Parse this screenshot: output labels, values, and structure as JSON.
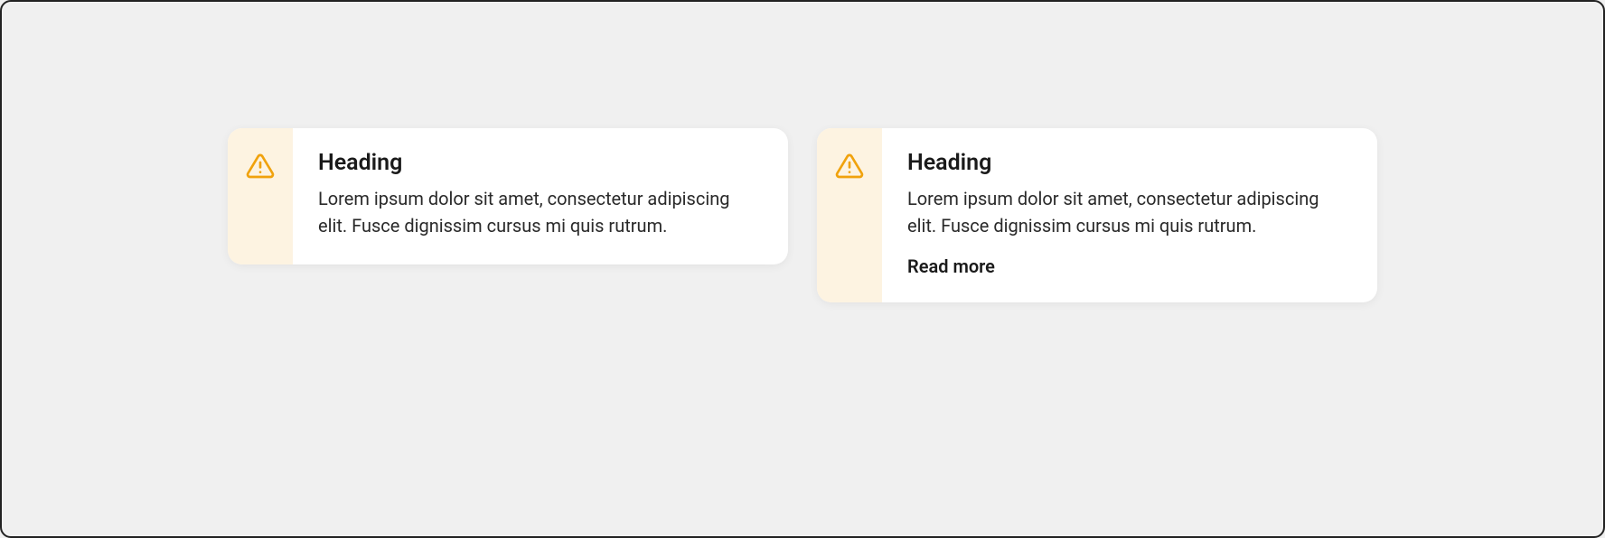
{
  "cards": [
    {
      "icon": "warning-triangle",
      "heading": "Heading",
      "body": "Lorem ipsum dolor sit amet, consectetur adipiscing elit. Fusce dignissim cursus mi quis rutrum.",
      "readMore": null
    },
    {
      "icon": "warning-triangle",
      "heading": "Heading",
      "body": "Lorem ipsum dolor sit amet, consectetur adipiscing elit. Fusce dignissim cursus mi quis rutrum.",
      "readMore": "Read more"
    }
  ],
  "colors": {
    "accent": "#f0a20d",
    "iconStripBg": "#fdf3e1"
  }
}
